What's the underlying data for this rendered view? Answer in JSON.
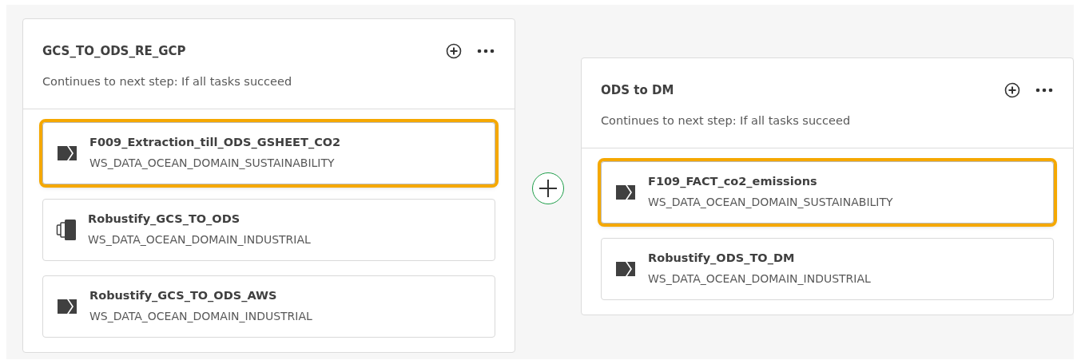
{
  "steps": [
    {
      "title": "GCS_TO_ODS_RE_GCP",
      "subtitle": "Continues to next step: If all tasks succeed",
      "tasks": [
        {
          "name": "F009_Extraction_till_ODS_GSHEET_CO2",
          "space": "WS_DATA_OCEAN_DOMAIN_SUSTAINABILITY",
          "kind": "transform",
          "selected": true
        },
        {
          "name": "Robustify_GCS_TO_ODS",
          "space": "WS_DATA_OCEAN_DOMAIN_INDUSTRIAL",
          "kind": "storage",
          "selected": false
        },
        {
          "name": "Robustify_GCS_TO_ODS_AWS",
          "space": "WS_DATA_OCEAN_DOMAIN_INDUSTRIAL",
          "kind": "transform",
          "selected": false
        }
      ]
    },
    {
      "title": "ODS to DM",
      "subtitle": "Continues to next step: If all tasks succeed",
      "tasks": [
        {
          "name": "F109_FACT_co2_emissions",
          "space": "WS_DATA_OCEAN_DOMAIN_SUSTAINABILITY",
          "kind": "transform",
          "selected": true
        },
        {
          "name": "Robustify_ODS_TO_DM",
          "space": "WS_DATA_OCEAN_DOMAIN_INDUSTRIAL",
          "kind": "transform",
          "selected": false
        }
      ]
    }
  ]
}
